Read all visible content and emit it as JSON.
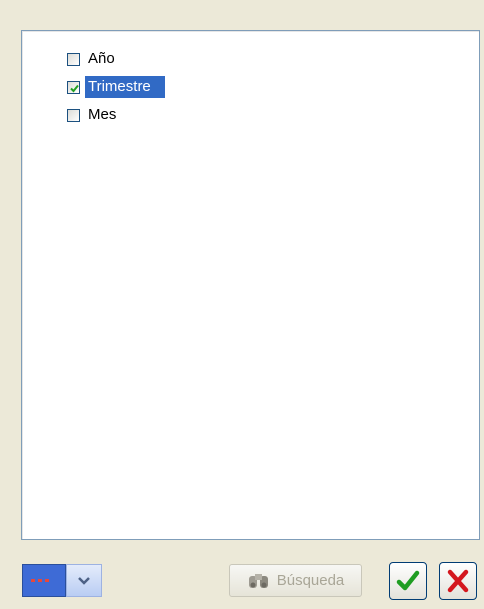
{
  "tree": {
    "items": [
      {
        "label": "Año",
        "checked": false,
        "selected": false
      },
      {
        "label": "Trimestre",
        "checked": true,
        "selected": true
      },
      {
        "label": "Mes",
        "checked": false,
        "selected": false
      }
    ]
  },
  "toolbar": {
    "search_label": "Búsqueda",
    "color_selector_value": "blue-dotted-line",
    "ok_icon": "checkmark-icon",
    "cancel_icon": "close-icon"
  },
  "colors": {
    "selection": "#316ac5",
    "swatch": "#3e6bd6",
    "swatch_dots": "#e8473b",
    "ok": "#1f9d22",
    "cancel": "#d4171e"
  }
}
